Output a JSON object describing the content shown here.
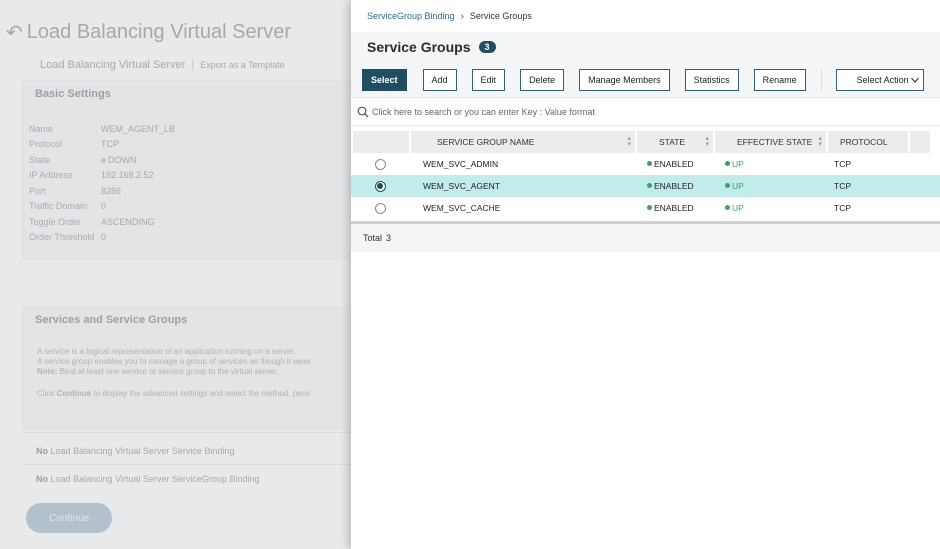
{
  "background": {
    "title": "Load Balancing Virtual Server",
    "subtitle": "Load Balancing Virtual Server",
    "export_label": "Export as a Template",
    "basic_settings": {
      "heading": "Basic Settings",
      "rows": [
        {
          "key": "Name",
          "value": "WEM_AGENT_LB"
        },
        {
          "key": "Protocol",
          "value": "TCP"
        },
        {
          "key": "State",
          "value": "DOWN"
        },
        {
          "key": "IP Address",
          "value": "192.168.2.52"
        },
        {
          "key": "Port",
          "value": "8286"
        },
        {
          "key": "Traffic Domain",
          "value": "0"
        },
        {
          "key": "Toggle Order",
          "value": "ASCENDING"
        },
        {
          "key": "Order Threshold",
          "value": "0"
        }
      ]
    },
    "services": {
      "heading": "Services and Service Groups",
      "line1": "A service is a logical representation of an application running on a server.",
      "line2": "A service group enables you to manage a group of services as though it were",
      "note_label": "Note:",
      "note_text": "Bind at least one service or service group to the virtual server.",
      "click_text_1": "Click",
      "click_bold": "Continue",
      "click_text_2": "to display the advanced settings and select the method, persi"
    },
    "binding1_bold": "No",
    "binding1_text": "Load Balancing Virtual Server Service Binding",
    "binding2_bold": "No",
    "binding2_text": "Load Balancing Virtual Server ServiceGroup Binding",
    "continue_label": "Continue"
  },
  "drawer": {
    "breadcrumb_link": "ServiceGroup Binding",
    "breadcrumb_current": "Service Groups",
    "title": "Service Groups",
    "count": "3",
    "toolbar": {
      "select": "Select",
      "add": "Add",
      "edit": "Edit",
      "delete": "Delete",
      "manage_members": "Manage Members",
      "statistics": "Statistics",
      "rename": "Rename",
      "select_action": "Select Action"
    },
    "search_placeholder": "Click here to search or you can enter Key : Value format",
    "columns": [
      "SERVICE GROUP NAME",
      "STATE",
      "EFFECTIVE STATE",
      "PROTOCOL"
    ],
    "rows": [
      {
        "name": "WEM_SVC_ADMIN",
        "state": "ENABLED",
        "effective": "UP",
        "protocol": "TCP",
        "selected": false
      },
      {
        "name": "WEM_SVC_AGENT",
        "state": "ENABLED",
        "effective": "UP",
        "protocol": "TCP",
        "selected": true
      },
      {
        "name": "WEM_SVC_CACHE",
        "state": "ENABLED",
        "effective": "UP",
        "protocol": "TCP",
        "selected": false
      }
    ],
    "footer_label": "Total",
    "footer_count": "3"
  },
  "colors": {
    "primary": "#1f4e63",
    "selected_row": "#c2ecec",
    "status_green": "#3aa655"
  }
}
